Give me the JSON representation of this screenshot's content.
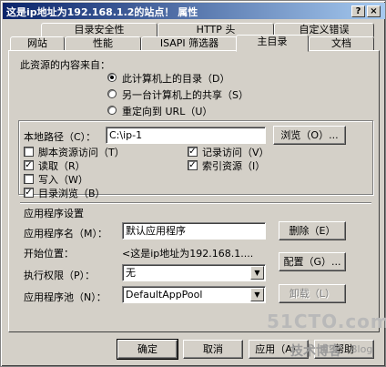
{
  "window": {
    "title": "这是ip地址为192.168.1.2的站点！ 属性",
    "help_glyph": "?",
    "close_glyph": "×"
  },
  "tabs": {
    "row1": [
      "目录安全性",
      "HTTP 头",
      "自定义错误"
    ],
    "row2": [
      "网站",
      "性能",
      "ISAPI 筛选器",
      "主目录",
      "文档"
    ],
    "active": "主目录"
  },
  "source": {
    "heading": "此资源的内容来自：",
    "options": [
      "此计算机上的目录（D）",
      "另一台计算机上的共享（S）",
      "重定向到 URL（U）"
    ],
    "selected_index": 0
  },
  "path": {
    "label": "本地路径（C）：",
    "value": "C:\\ip-1",
    "browse_button": "浏览（O）..."
  },
  "permissions": {
    "left": [
      {
        "label": "脚本资源访问（T）",
        "checked": false
      },
      {
        "label": "读取（R）",
        "checked": true
      },
      {
        "label": "写入（W）",
        "checked": false
      },
      {
        "label": "目录浏览（B）",
        "checked": true
      }
    ],
    "right": [
      {
        "label": "记录访问（V）",
        "checked": true
      },
      {
        "label": "索引资源（I）",
        "checked": true
      }
    ],
    "check_glyph": "✓"
  },
  "app_settings": {
    "heading": "应用程序设置",
    "app_name_label": "应用程序名（M）：",
    "app_name_value": "默认应用程序",
    "remove_button": "删除（E）",
    "start_label": "开始位置：",
    "start_value": "<这是ip地址为192.168.1....",
    "exec_label": "执行权限（P）：",
    "exec_value": "无",
    "config_button": "配置（G）...",
    "pool_label": "应用程序池（N）：",
    "pool_value": "DefaultAppPool",
    "unload_button": "卸载（L）"
  },
  "footer": {
    "ok": "确定",
    "cancel": "取消",
    "apply": "应用（A）",
    "help": "帮助"
  },
  "watermark": {
    "site": "51CTO.com",
    "tagline": "技术博客",
    "blog": "Blog"
  }
}
